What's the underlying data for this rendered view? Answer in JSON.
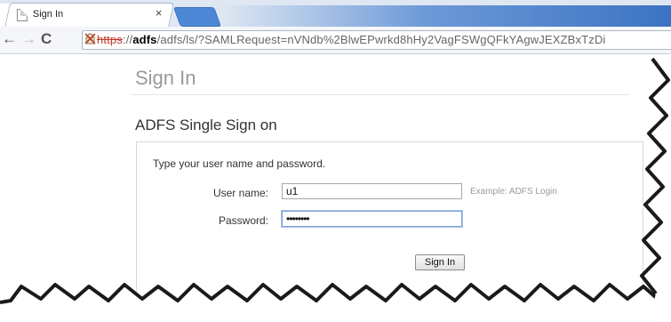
{
  "browser": {
    "tab_title": "Sign In",
    "tab_close": "×",
    "url_scheme": "https",
    "url_sep": "://",
    "url_host": "adfs",
    "url_path": "/adfs/ls/?SAMLRequest=nVNdb%2BlwEPwrkd8hHy2VagFSWgQFkYAgwJEXZBxTzDi",
    "icons": {
      "back": "←",
      "forward": "→",
      "reload": "C"
    }
  },
  "page": {
    "title": "Sign In",
    "section_title": "ADFS Single Sign on",
    "instructions": "Type your user name and password.",
    "username_label": "User name:",
    "username_value": "u1",
    "username_hint": "Example: ADFS Login",
    "password_label": "Password:",
    "password_value": "••••••••",
    "signin_button": "Sign In"
  },
  "colors": {
    "tab_accent": "#4d87d6",
    "insecure_scheme": "#c0392b",
    "title_gray": "#9a9a9a"
  }
}
